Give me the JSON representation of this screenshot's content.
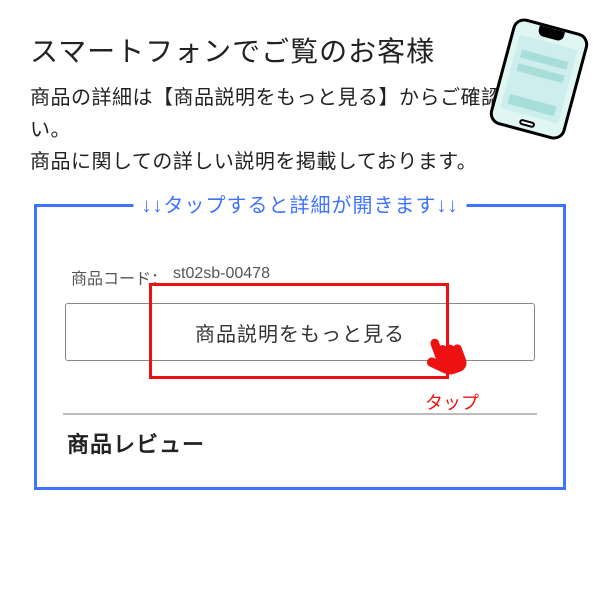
{
  "title": "スマートフォンでご覧のお客様",
  "desc_line1": "商品の詳細は【商品説明をもっと見る】からご確認下さい。",
  "desc_line2": "商品に関しての詳しい説明を掲載しております。",
  "legend": "↓↓タップすると詳細が開きます↓↓",
  "code": {
    "label": "商品コード：",
    "value": "st02sb-00478"
  },
  "button_label": "商品説明をもっと見る",
  "tap_label": "タップ",
  "review_heading": "商品レビュー"
}
